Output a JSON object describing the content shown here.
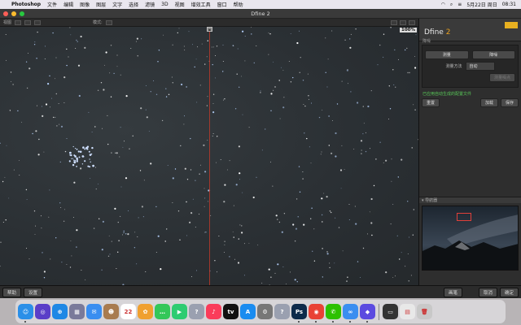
{
  "menubar": {
    "app": "Photoshop",
    "items": [
      "文件",
      "编辑",
      "图像",
      "图层",
      "文字",
      "选择",
      "滤镜",
      "3D",
      "视图",
      "增效工具",
      "窗口",
      "帮助"
    ],
    "date": "5月22日 周日",
    "time": "08:31"
  },
  "window": {
    "title": "Dfine 2"
  },
  "toolbar": {
    "view_label": "视图",
    "mode_label": "模式:"
  },
  "canvas": {
    "zoom": "100%",
    "divider_handle": "◂▸"
  },
  "panel": {
    "product": "Dfine",
    "version": "2",
    "subtitle": "降噪",
    "measure_button": "测量",
    "reduce_button": "降噪",
    "method_label": "测量方法",
    "method_value": "自动",
    "measure_noise_button": "测量噪点",
    "status_text": "已应用自动生成的配置文件",
    "reset_button": "重置",
    "load_button": "加载",
    "save_button": "保存",
    "navigator_label": "导航器"
  },
  "bottombar": {
    "help_button": "帮助",
    "settings_button": "设置",
    "brush_button": "画笔",
    "cancel_button": "取消",
    "ok_button": "确定"
  },
  "dock": {
    "apps": [
      {
        "name": "finder-icon",
        "color": "#2a8fe8",
        "glyph": "☺"
      },
      {
        "name": "siri-icon",
        "color": "#5a3ec8",
        "glyph": "◎"
      },
      {
        "name": "safari-icon",
        "color": "#1e88e5",
        "glyph": "⊕"
      },
      {
        "name": "launchpad-icon",
        "color": "#7a7a9a",
        "glyph": "▦"
      },
      {
        "name": "mail-icon",
        "color": "#3a8ef0",
        "glyph": "✉"
      },
      {
        "name": "contacts-icon",
        "color": "#a87b4f",
        "glyph": "☻"
      },
      {
        "name": "calendar-icon",
        "color": "#ffffff",
        "glyph": "22"
      },
      {
        "name": "photos-icon",
        "color": "#f0a030",
        "glyph": "✿"
      },
      {
        "name": "messages-icon",
        "color": "#34c759",
        "glyph": "…"
      },
      {
        "name": "facetime-icon",
        "color": "#2ecc71",
        "glyph": "▶"
      },
      {
        "name": "unknown-app-icon",
        "color": "#9aa0b0",
        "glyph": "?"
      },
      {
        "name": "music-icon",
        "color": "#fa3c5a",
        "glyph": "♪"
      },
      {
        "name": "tv-icon",
        "color": "#111111",
        "glyph": "tv"
      },
      {
        "name": "appstore-icon",
        "color": "#1a8cf0",
        "glyph": "A"
      },
      {
        "name": "system-preferences-icon",
        "color": "#777777",
        "glyph": "⚙"
      },
      {
        "name": "unknown-app-icon-2",
        "color": "#9aa0b0",
        "glyph": "?"
      },
      {
        "name": "photoshop-icon",
        "color": "#0d2a4a",
        "glyph": "Ps"
      },
      {
        "name": "chrome-icon",
        "color": "#e94235",
        "glyph": "◉"
      },
      {
        "name": "wechat-icon",
        "color": "#2dc100",
        "glyph": "✆"
      },
      {
        "name": "baidu-netdisk-icon",
        "color": "#3a8ef0",
        "glyph": "∞"
      },
      {
        "name": "vpn-icon",
        "color": "#5b4be0",
        "glyph": "◆"
      },
      {
        "name": "terminal-preview-icon",
        "color": "#333333",
        "glyph": "▭"
      },
      {
        "name": "preview-icon",
        "color": "#e8e8e8",
        "glyph": "▤"
      },
      {
        "name": "trash-icon",
        "color": "#c8c8c8",
        "glyph": "🗑"
      }
    ]
  }
}
